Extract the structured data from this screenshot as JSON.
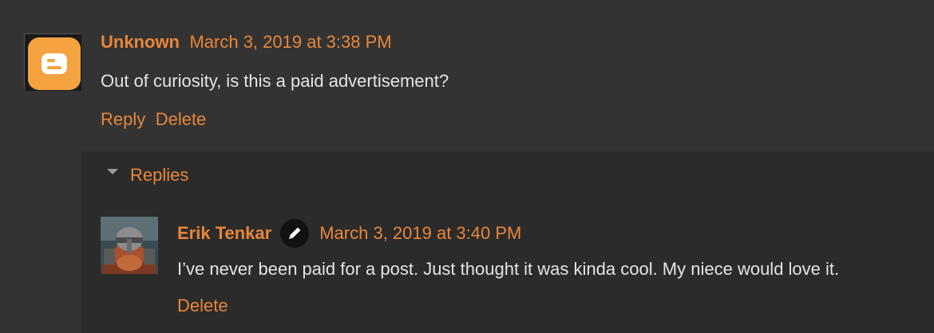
{
  "comment": {
    "author": "Unknown",
    "date": "March 3, 2019 at 3:38 PM",
    "text": "Out of curiosity, is this a paid advertisement?",
    "reply_label": "Reply",
    "delete_label": "Delete"
  },
  "replies": {
    "toggle_label": "Replies",
    "items": [
      {
        "author": "Erik Tenkar",
        "date": "March 3, 2019 at 3:40 PM",
        "text": "I’ve never been paid for a post. Just thought it was kinda cool. My niece would love it.",
        "delete_label": "Delete"
      }
    ]
  },
  "icons": {
    "avatar": "blogger-logo-icon",
    "toggle": "triangle-down-icon",
    "edit": "pencil-icon"
  },
  "colors": {
    "background": "#333333",
    "replies_background": "#2b2b2b",
    "accent": "#e8863a",
    "text": "#e4e4e4",
    "blogger_orange": "#f4a340"
  }
}
